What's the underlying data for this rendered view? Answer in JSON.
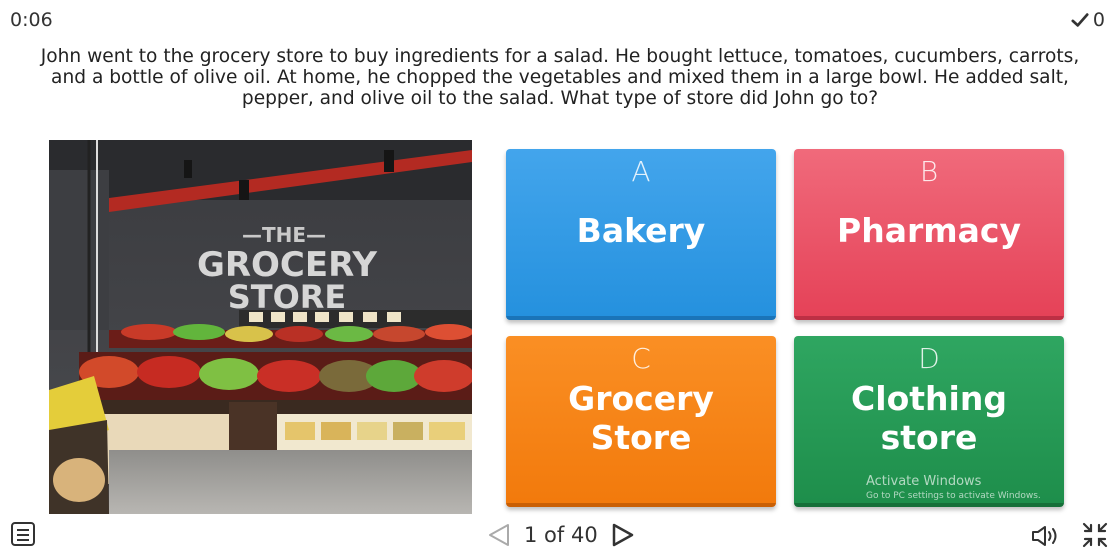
{
  "timer": "0:06",
  "score": {
    "value": "0",
    "icon": "checkmark-icon"
  },
  "question": "John went to the grocery store to buy ingredients for a salad. He bought lettuce, tomatoes, cucumbers, carrots, and a bottle of olive oil. At home, he chopped the vegetables and mixed them in a large bowl. He added salt, pepper, and olive oil to the salad. What type of store did John go to?",
  "image": {
    "sign_line1": "—THE—",
    "sign_line2": "GROCERY",
    "sign_line3": "STORE"
  },
  "answers": [
    {
      "letter": "A",
      "text": "Bakery",
      "color": "#2591de"
    },
    {
      "letter": "B",
      "text": "Pharmacy",
      "color": "#e54258"
    },
    {
      "letter": "C",
      "text": "Grocery Store",
      "color": "#f27a0c"
    },
    {
      "letter": "D",
      "text": "Clothing store",
      "color": "#1e8e4b"
    }
  ],
  "watermark": {
    "line1": "Activate Windows",
    "line2": "Go to PC settings to activate Windows."
  },
  "pager": {
    "text": "1 of 40"
  }
}
